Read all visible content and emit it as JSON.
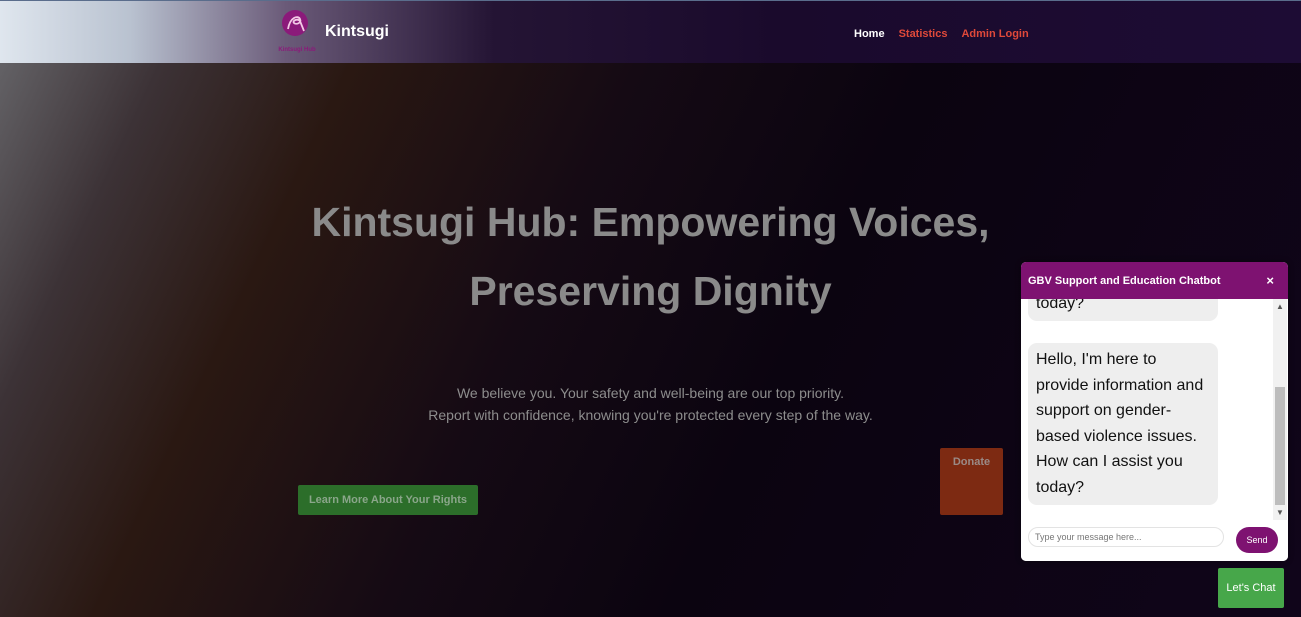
{
  "header": {
    "logo_caption": "Kintsugi Hub",
    "brand": "Kintsugi",
    "nav": [
      "Home",
      "Statistics",
      "Admin Login"
    ]
  },
  "hero": {
    "title_line1": "Kintsugi Hub: Empowering Voices,",
    "title_line2": "Preserving Dignity",
    "subtitle_line1": "We believe you. Your safety and well-being are our top priority.",
    "subtitle_line2": "Report with confidence, knowing you're protected every step of the way.",
    "learn_button": "Learn More About Your Rights",
    "donate_button": "Donate"
  },
  "chatbot": {
    "title": "GBV Support and Education Chatbot",
    "close": "×",
    "messages": [
      "today?",
      "Hello, I'm here to provide information and support on gender-based violence issues. How can I assist you today?"
    ],
    "input_placeholder": "Type your message here...",
    "send_label": "Send",
    "open_label": "Let's Chat"
  },
  "colors": {
    "brand_purple": "#7e1271",
    "nav_link": "#e0493a",
    "learn_green": "#2c6e2a",
    "donate_brown": "#7d2a12",
    "chat_green": "#47a74a"
  }
}
